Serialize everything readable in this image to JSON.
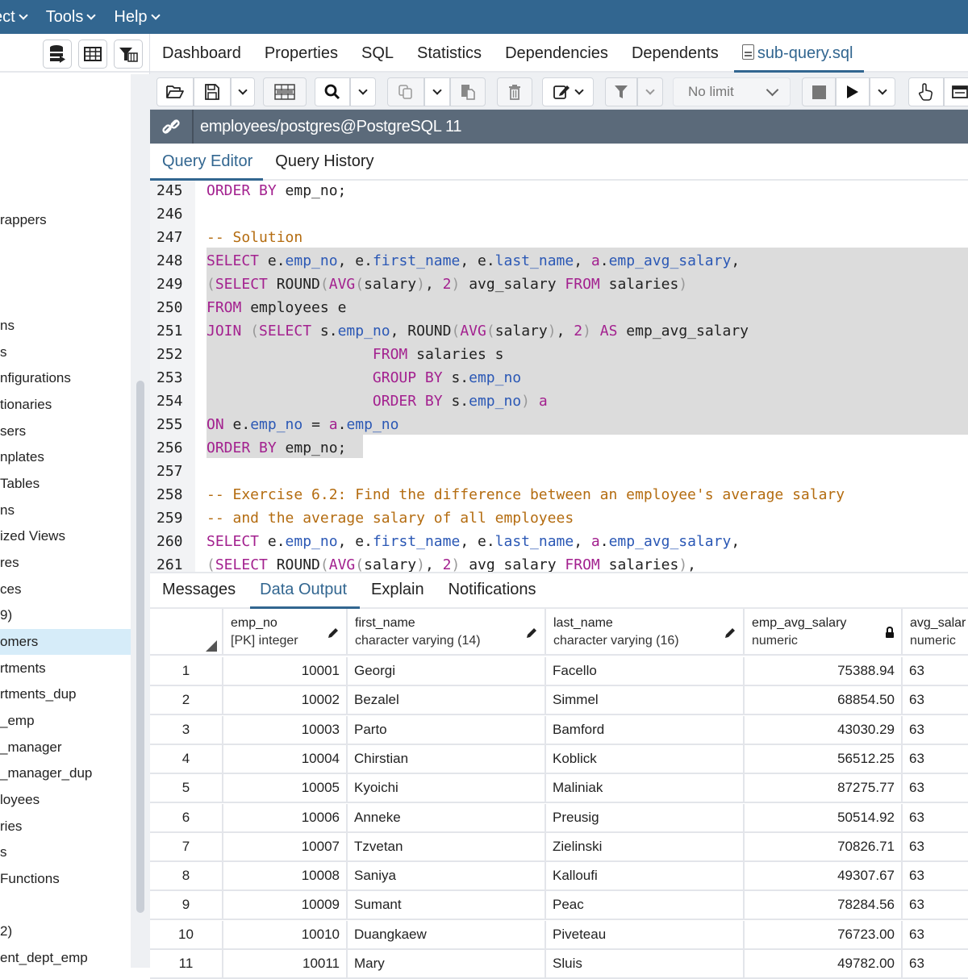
{
  "menubar": {
    "items": [
      "ect",
      "Tools",
      "Help"
    ]
  },
  "sidebar": {
    "toolbar_icons": [
      "query-tool-icon",
      "view-data-icon",
      "filter-rows-icon"
    ],
    "tree_items": [
      {
        "label": "rappers",
        "top": 0
      },
      {
        "label": "ns"
      },
      {
        "label": "s"
      },
      {
        "label": "nfigurations"
      },
      {
        "label": "tionaries"
      },
      {
        "label": "sers"
      },
      {
        "label": "nplates"
      },
      {
        "label": " Tables"
      },
      {
        "label": "ns"
      },
      {
        "label": "ized Views"
      },
      {
        "label": "res"
      },
      {
        "label": "ces"
      },
      {
        "label": "9)"
      },
      {
        "label": "omers",
        "selected": true
      },
      {
        "label": "rtments"
      },
      {
        "label": "rtments_dup"
      },
      {
        "label": "_emp"
      },
      {
        "label": "_manager"
      },
      {
        "label": "_manager_dup"
      },
      {
        "label": "loyees"
      },
      {
        "label": "ries"
      },
      {
        "label": "s"
      },
      {
        "label": "Functions"
      },
      {
        "label": ""
      },
      {
        "label": "2)"
      },
      {
        "label": "ent_dept_emp"
      }
    ]
  },
  "tabs": {
    "items": [
      "Dashboard",
      "Properties",
      "SQL",
      "Statistics",
      "Dependencies",
      "Dependents"
    ],
    "active_file": "sub-query.sql"
  },
  "query_toolbar": {
    "limit_value": "No limit"
  },
  "connection": {
    "label": "employees/postgres@PostgreSQL 11"
  },
  "editor_tabs": {
    "items": [
      "Query Editor",
      "Query History"
    ],
    "active": "Query Editor"
  },
  "editor": {
    "lines": [
      {
        "n": "245",
        "text": "ORDER BY emp_no;"
      },
      {
        "n": "246",
        "text": ""
      },
      {
        "n": "247",
        "text": "-- Solution"
      },
      {
        "n": "248",
        "text": "SELECT e.emp_no, e.first_name, e.last_name, a.emp_avg_salary,"
      },
      {
        "n": "249",
        "text": "(SELECT ROUND(AVG(salary), 2) avg_salary FROM salaries)"
      },
      {
        "n": "250",
        "text": "FROM employees e"
      },
      {
        "n": "251",
        "text": "JOIN (SELECT s.emp_no, ROUND(AVG(salary), 2) AS emp_avg_salary"
      },
      {
        "n": "252",
        "text": "                 FROM salaries s"
      },
      {
        "n": "253",
        "text": "                 GROUP BY s.emp_no"
      },
      {
        "n": "254",
        "text": "                 ORDER BY s.emp_no) a"
      },
      {
        "n": "255",
        "text": "ON e.emp_no = a.emp_no"
      },
      {
        "n": "256",
        "text": "ORDER BY emp_no;"
      },
      {
        "n": "257",
        "text": ""
      },
      {
        "n": "258",
        "text": "-- Exercise 6.2: Find the difference between an employee's average salary"
      },
      {
        "n": "259",
        "text": "-- and the average salary of all employees"
      },
      {
        "n": "260",
        "text": "SELECT e.emp_no, e.first_name, e.last_name, a.emp_avg_salary,"
      },
      {
        "n": "261",
        "text": "(SELECT ROUND(AVG(salary), 2) avg_salary FROM salaries),"
      }
    ]
  },
  "results_tabs": {
    "items": [
      "Messages",
      "Data Output",
      "Explain",
      "Notifications"
    ],
    "active": "Data Output"
  },
  "grid": {
    "columns": [
      {
        "name": "emp_no",
        "type": "[PK] integer",
        "icon": "edit-pencil-icon"
      },
      {
        "name": "first_name",
        "type": "character varying (14)",
        "icon": "edit-pencil-icon"
      },
      {
        "name": "last_name",
        "type": "character varying (16)",
        "icon": "edit-pencil-icon"
      },
      {
        "name": "emp_avg_salary",
        "type": "numeric",
        "icon": "lock-icon"
      },
      {
        "name": "avg_salar",
        "type": "numeric",
        "icon": ""
      }
    ],
    "rows": [
      {
        "idx": "1",
        "emp_no": "10001",
        "first_name": "Georgi",
        "last_name": "Facello",
        "emp_avg_salary": "75388.94",
        "avg_salary": "63"
      },
      {
        "idx": "2",
        "emp_no": "10002",
        "first_name": "Bezalel",
        "last_name": "Simmel",
        "emp_avg_salary": "68854.50",
        "avg_salary": "63"
      },
      {
        "idx": "3",
        "emp_no": "10003",
        "first_name": "Parto",
        "last_name": "Bamford",
        "emp_avg_salary": "43030.29",
        "avg_salary": "63"
      },
      {
        "idx": "4",
        "emp_no": "10004",
        "first_name": "Chirstian",
        "last_name": "Koblick",
        "emp_avg_salary": "56512.25",
        "avg_salary": "63"
      },
      {
        "idx": "5",
        "emp_no": "10005",
        "first_name": "Kyoichi",
        "last_name": "Maliniak",
        "emp_avg_salary": "87275.77",
        "avg_salary": "63"
      },
      {
        "idx": "6",
        "emp_no": "10006",
        "first_name": "Anneke",
        "last_name": "Preusig",
        "emp_avg_salary": "50514.92",
        "avg_salary": "63"
      },
      {
        "idx": "7",
        "emp_no": "10007",
        "first_name": "Tzvetan",
        "last_name": "Zielinski",
        "emp_avg_salary": "70826.71",
        "avg_salary": "63"
      },
      {
        "idx": "8",
        "emp_no": "10008",
        "first_name": "Saniya",
        "last_name": "Kalloufi",
        "emp_avg_salary": "49307.67",
        "avg_salary": "63"
      },
      {
        "idx": "9",
        "emp_no": "10009",
        "first_name": "Sumant",
        "last_name": "Peac",
        "emp_avg_salary": "78284.56",
        "avg_salary": "63"
      },
      {
        "idx": "10",
        "emp_no": "10010",
        "first_name": "Duangkaew",
        "last_name": "Piveteau",
        "emp_avg_salary": "76723.00",
        "avg_salary": "63"
      },
      {
        "idx": "11",
        "emp_no": "10011",
        "first_name": "Mary",
        "last_name": "Sluis",
        "emp_avg_salary": "49782.00",
        "avg_salary": "63"
      }
    ]
  },
  "colors": {
    "brand": "#326690",
    "connection_bar": "#5b6a7a",
    "selected_tree_item": "#d6ecf9",
    "keyword": "#a3218f",
    "comment": "#b46c10",
    "identifier": "#2b58b5",
    "selection": "#dcdcdc"
  }
}
